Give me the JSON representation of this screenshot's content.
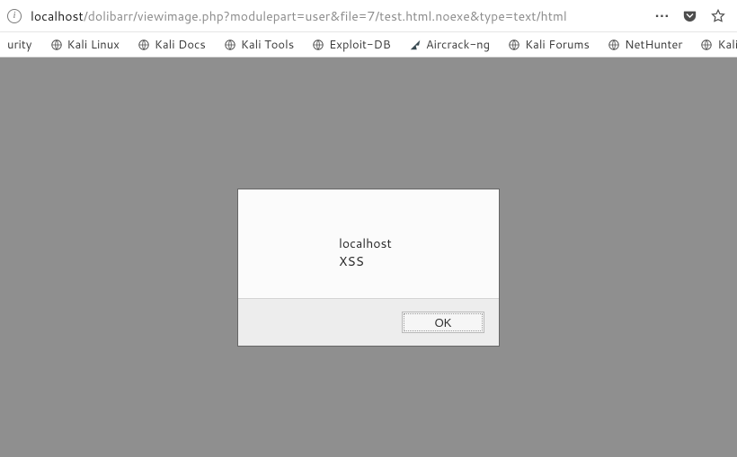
{
  "url": {
    "host": "localhost",
    "rest": "/dolibarr/viewimage.php?modulepart=user&file=7/test.html.noexe&type=text/html"
  },
  "bookmarks": [
    {
      "label": "urity",
      "icon": "none"
    },
    {
      "label": "Kali Linux",
      "icon": "globe"
    },
    {
      "label": "Kali Docs",
      "icon": "globe"
    },
    {
      "label": "Kali Tools",
      "icon": "globe"
    },
    {
      "label": "Exploit-DB",
      "icon": "globe"
    },
    {
      "label": "Aircrack-ng",
      "icon": "aircrack"
    },
    {
      "label": "Kali Forums",
      "icon": "globe"
    },
    {
      "label": "NetHunter",
      "icon": "globe"
    },
    {
      "label": "Kali Tra",
      "icon": "globe"
    }
  ],
  "alert": {
    "origin": "localhost",
    "message": "XSS",
    "ok_label": "OK"
  }
}
